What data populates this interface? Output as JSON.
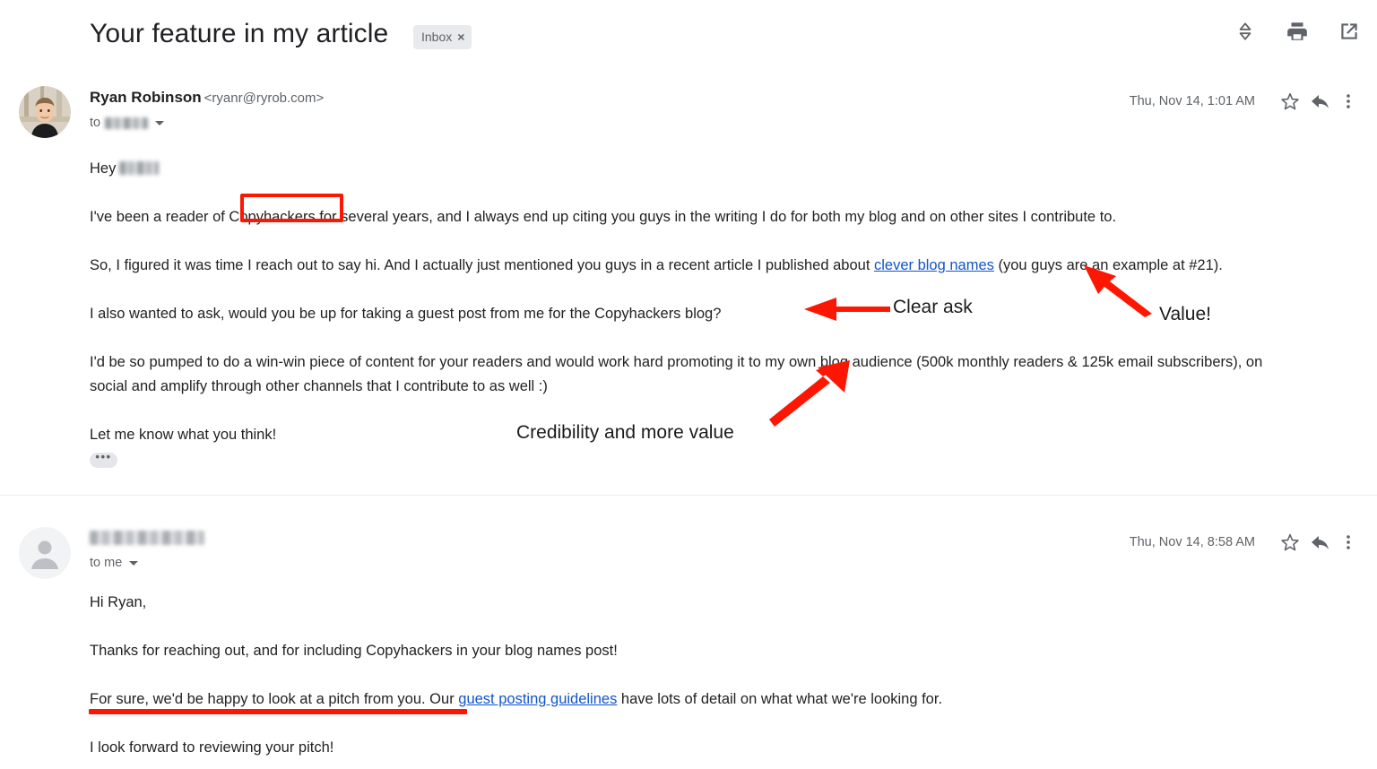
{
  "header": {
    "subject": "Your feature in my article",
    "label_chip": "Inbox",
    "label_chip_close": "×",
    "actions": [
      {
        "name": "expand-collapse-icon",
        "title": "Expand all"
      },
      {
        "name": "print-icon",
        "title": "Print all"
      },
      {
        "name": "open-in-new-window-icon",
        "title": "Open in new window"
      }
    ]
  },
  "messages": [
    {
      "sender_name": "Ryan Robinson",
      "sender_email": "<ryanr@ryrob.com>",
      "to_label": "to",
      "to_value_redacted": true,
      "date": "Thu, Nov 14, 1:01 AM",
      "avatar_type": "photo",
      "greeting_prefix": "Hey",
      "paragraphs": [
        "I've been a reader of Copyhackers for several years, and I always end up citing you guys in the writing I do for both my blog and on other sites I contribute to.",
        "So, I figured it was time I reach out to say hi. And I actually just mentioned you guys in a recent article I published about clever blog names (you guys are an example at #21).",
        "I also wanted to ask, would you be up for taking a guest post from me for the Copyhackers blog?",
        "I'd be so pumped to do a win-win piece of content for your readers and would work hard promoting it to my own blog audience (500k monthly readers & 125k email subscribers), on social and amplify through other channels that I contribute to as well :)",
        "Let me know what you think!"
      ],
      "p2_before_link": "So, I figured it was time I reach out to say hi. And I actually just mentioned you guys in a recent article I published about ",
      "p2_link": "clever blog names",
      "p2_after_link": " (you guys are an example at #21).",
      "trimmed_content_label": "•••"
    },
    {
      "sender_name_redacted": true,
      "to_label": "to me",
      "date": "Thu, Nov 14, 8:58 AM",
      "avatar_type": "default-person",
      "paragraphs": [
        "Hi Ryan,",
        "Thanks for reaching out, and for including Copyhackers in your blog names post!",
        "For sure, we'd be happy to look at a pitch from you. Our guest posting guidelines have lots of detail on what what we're looking for.",
        "I look forward to reviewing your pitch!"
      ],
      "p3_before_link": "For sure, we'd be happy to look at a pitch from you. Our ",
      "p3_link": "guest posting guidelines",
      "p3_after_link": " have lots of detail on what what we're looking for."
    }
  ],
  "annotations": {
    "color": "#fc1703",
    "box_target": "Copyhackers",
    "labels": {
      "clear_ask": "Clear ask",
      "value": "Value!",
      "credibility": "Credibility and more value"
    },
    "underline_target": "For sure, we'd be happy to look at a pitch from you."
  },
  "colors": {
    "link": "#1155cc",
    "text": "#222222",
    "muted": "#5f6368",
    "chip_bg": "#e8eaed",
    "annotation_red": "#fc1703"
  }
}
